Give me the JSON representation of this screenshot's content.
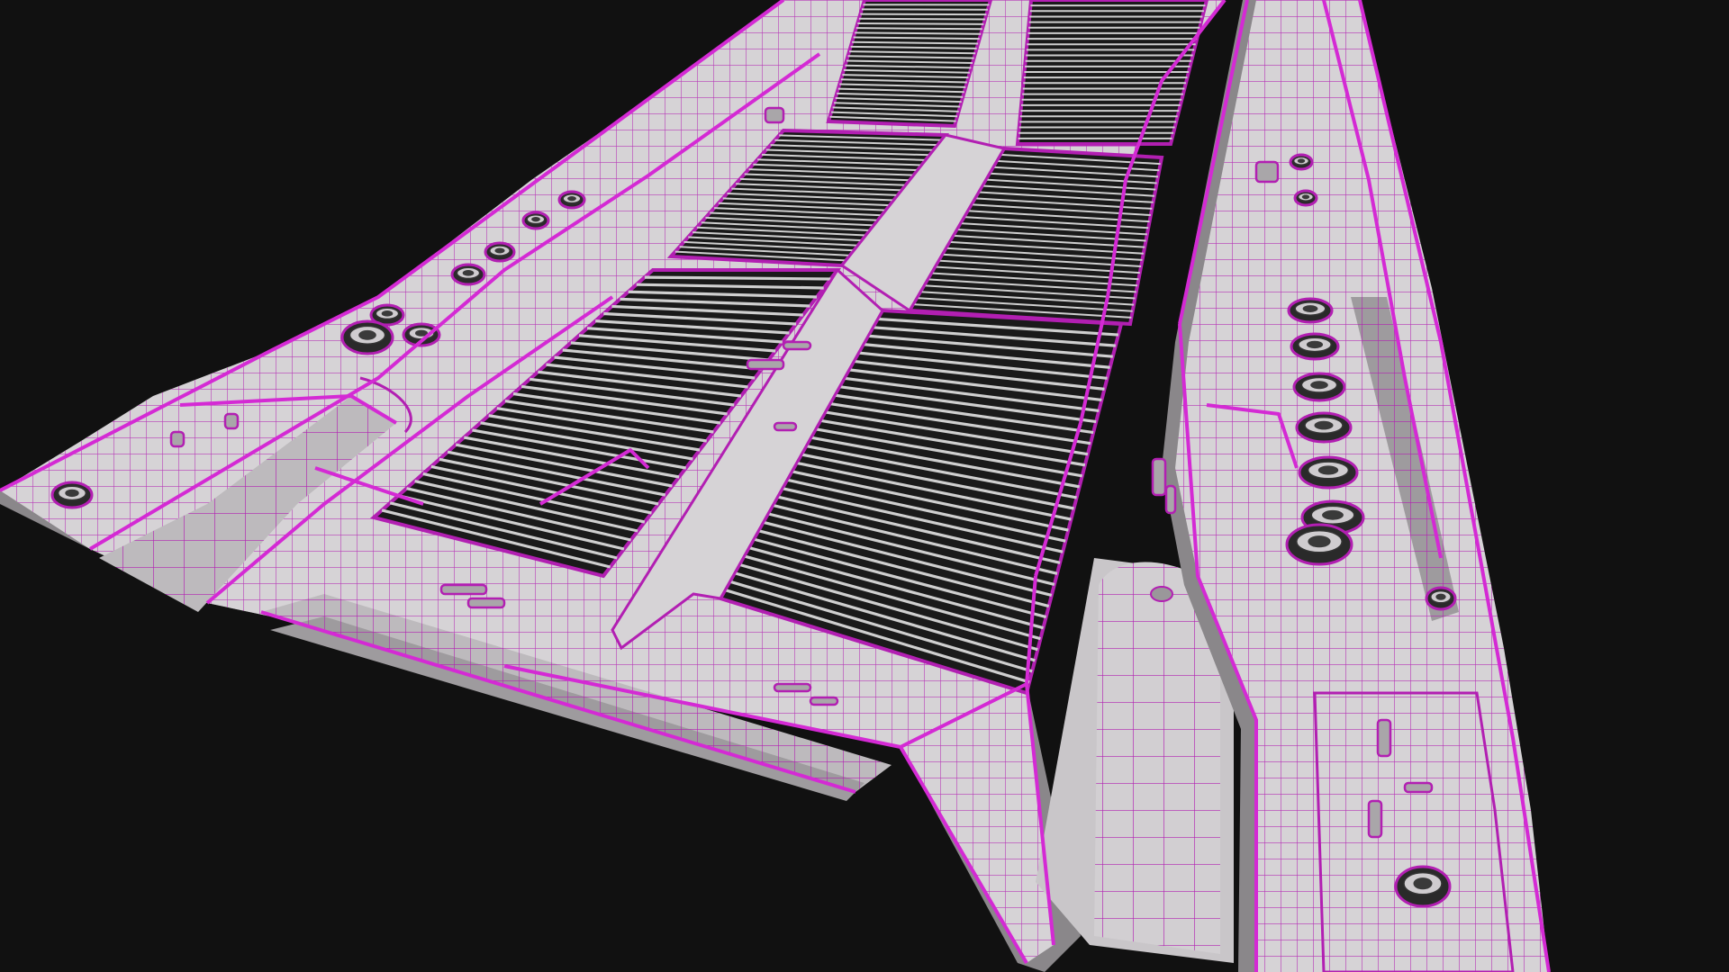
{
  "scene": {
    "type": "3d-wireframe-viewport",
    "subject": "sci-fi-floor-panel",
    "colors": {
      "background": "#111111",
      "surface": "#d6d3d6",
      "surface_shade": "#a9a6a9",
      "surface_dark": "#7e7b7e",
      "wire": "#b21fb2",
      "wire_bright": "#d42ad4",
      "grate_bg": "#1a1a1a",
      "grate_bar": "#cfcfcf",
      "hole": "#2a2a2a"
    }
  }
}
